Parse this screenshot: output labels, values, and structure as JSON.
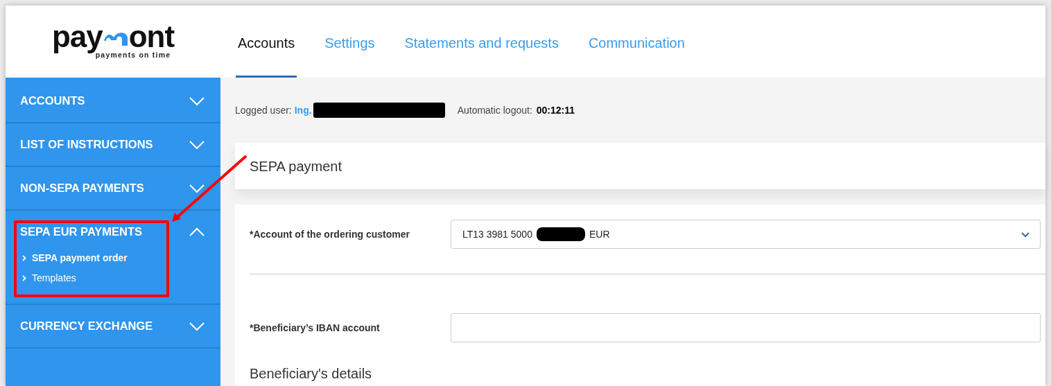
{
  "logo": {
    "name_start": "pay",
    "name_end": "ont",
    "tagline": "payments on time"
  },
  "tabs": [
    {
      "label": "Accounts",
      "selected": true
    },
    {
      "label": "Settings",
      "selected": false
    },
    {
      "label": "Statements and requests",
      "selected": false
    },
    {
      "label": "Communication",
      "selected": false
    }
  ],
  "sidebar": {
    "sections": [
      {
        "label": "ACCOUNTS",
        "expanded": false,
        "highlighted": false
      },
      {
        "label": "LIST OF INSTRUCTIONS",
        "expanded": false,
        "highlighted": false
      },
      {
        "label": "NON-SEPA PAYMENTS",
        "expanded": false,
        "highlighted": false
      },
      {
        "label": "SEPA EUR PAYMENTS",
        "expanded": true,
        "highlighted": true,
        "children": [
          {
            "label": "SEPA payment order",
            "selected": true
          },
          {
            "label": "Templates",
            "selected": false
          }
        ]
      },
      {
        "label": "CURRENCY EXCHANGE",
        "expanded": false,
        "highlighted": false
      }
    ]
  },
  "session": {
    "user_label": "Logged user:",
    "user_value": "Ing.",
    "logout_label": "Automatic logout:",
    "logout_value": "00:12:11"
  },
  "page_title": "SEPA payment",
  "form": {
    "fields": [
      {
        "kind": "select",
        "label": "*Account of the ordering customer",
        "value_start": "LT13 3981 5000",
        "value_end": "EUR"
      },
      {
        "kind": "input",
        "label": "*Beneficiary’s IBAN account"
      }
    ],
    "section_title": "Beneficiary's details"
  }
}
